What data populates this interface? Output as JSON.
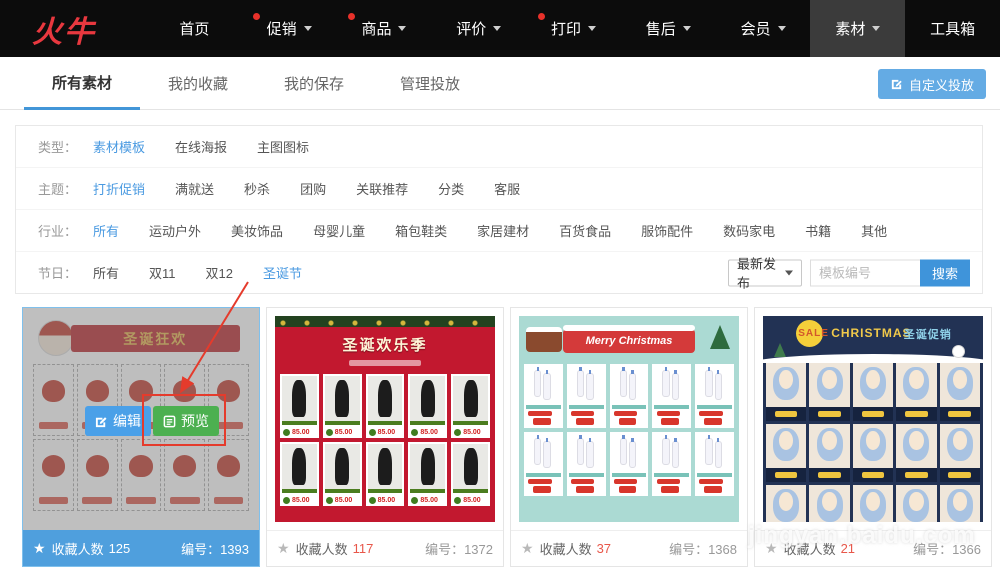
{
  "colors": {
    "accent_blue": "#4a9ae1",
    "nav_bg": "#0c0c0c",
    "nav_active_bg": "#3b3b3b",
    "logo_red": "#e8383f",
    "notification_dot_red": "#e8312a",
    "search_button_blue": "#3f94da",
    "custom_button_blue": "#64abe4",
    "selected_footer_blue": "#4f9fdd",
    "edit_button_blue": "#4aa0e8",
    "preview_button_green": "#4cb050",
    "annotation_red": "#e53b2c",
    "fav_count_red": "#e8574a"
  },
  "nav": {
    "logo": "火牛",
    "items": [
      {
        "label": "首页",
        "dot": false,
        "caret": false,
        "active": false
      },
      {
        "label": "促销",
        "dot": true,
        "caret": true,
        "active": false
      },
      {
        "label": "商品",
        "dot": true,
        "caret": true,
        "active": false
      },
      {
        "label": "评价",
        "dot": false,
        "caret": true,
        "active": false
      },
      {
        "label": "打印",
        "dot": true,
        "caret": true,
        "active": false
      },
      {
        "label": "售后",
        "dot": false,
        "caret": true,
        "active": false
      },
      {
        "label": "会员",
        "dot": false,
        "caret": true,
        "active": false
      },
      {
        "label": "素材",
        "dot": false,
        "caret": true,
        "active": true
      },
      {
        "label": "工具箱",
        "dot": false,
        "caret": false,
        "active": false
      }
    ]
  },
  "tabs": {
    "items": [
      {
        "label": "所有素材",
        "active": true
      },
      {
        "label": "我的收藏",
        "active": false
      },
      {
        "label": "我的保存",
        "active": false
      },
      {
        "label": "管理投放",
        "active": false
      }
    ],
    "custom_button_label": "自定义投放"
  },
  "filters": {
    "rows": [
      {
        "label": "类型：",
        "options": [
          {
            "text": "素材模板",
            "active": true
          },
          {
            "text": "在线海报",
            "active": false
          },
          {
            "text": "主图图标",
            "active": false
          }
        ]
      },
      {
        "label": "主题：",
        "options": [
          {
            "text": "打折促销",
            "active": true
          },
          {
            "text": "满就送",
            "active": false
          },
          {
            "text": "秒杀",
            "active": false
          },
          {
            "text": "团购",
            "active": false
          },
          {
            "text": "关联推荐",
            "active": false
          },
          {
            "text": "分类",
            "active": false
          },
          {
            "text": "客服",
            "active": false
          }
        ]
      },
      {
        "label": "行业：",
        "options": [
          {
            "text": "所有",
            "active": true
          },
          {
            "text": "运动户外",
            "active": false
          },
          {
            "text": "美妆饰品",
            "active": false
          },
          {
            "text": "母婴儿童",
            "active": false
          },
          {
            "text": "箱包鞋类",
            "active": false
          },
          {
            "text": "家居建材",
            "active": false
          },
          {
            "text": "百货食品",
            "active": false
          },
          {
            "text": "服饰配件",
            "active": false
          },
          {
            "text": "数码家电",
            "active": false
          },
          {
            "text": "书籍",
            "active": false
          },
          {
            "text": "其他",
            "active": false
          }
        ]
      },
      {
        "label": "节日：",
        "options": [
          {
            "text": "所有",
            "active": false
          },
          {
            "text": "双11",
            "active": false
          },
          {
            "text": "双12",
            "active": false
          },
          {
            "text": "圣诞节",
            "active": true
          }
        ]
      }
    ],
    "sort_value": "最新发布",
    "search_placeholder": "模板编号",
    "search_button": "搜索"
  },
  "cards": [
    {
      "selected": true,
      "theme": "t1",
      "fav_label": "收藏人数",
      "fav_count": "125",
      "code_label": "编号：",
      "code": "1393",
      "overlay": {
        "edit_label": "编辑",
        "preview_label": "预览"
      },
      "thumb": {
        "banner_title": "圣诞狂欢",
        "rows": 2,
        "cols": 5
      }
    },
    {
      "selected": false,
      "theme": "t2",
      "fav_label": "收藏人数",
      "fav_count": "117",
      "code_label": "编号：",
      "code": "1372",
      "thumb": {
        "banner_title": "圣诞欢乐季",
        "rows": 2,
        "cols": 5,
        "price": "85.00"
      }
    },
    {
      "selected": false,
      "theme": "t3",
      "fav_label": "收藏人数",
      "fav_count": "37",
      "code_label": "编号：",
      "code": "1368",
      "thumb": {
        "banner_title": "Merry  Christmas",
        "rows": 2,
        "cols": 5
      }
    },
    {
      "selected": false,
      "theme": "t4",
      "fav_label": "收藏人数",
      "fav_count": "21",
      "code_label": "编号：",
      "code": "1366",
      "thumb": {
        "banner_sale": "SALE",
        "banner_title": "CHRISTMAS",
        "banner_badge": "圣诞促销",
        "rows": 3,
        "cols": 5
      }
    }
  ],
  "watermark": "jingyan.baidu.com"
}
